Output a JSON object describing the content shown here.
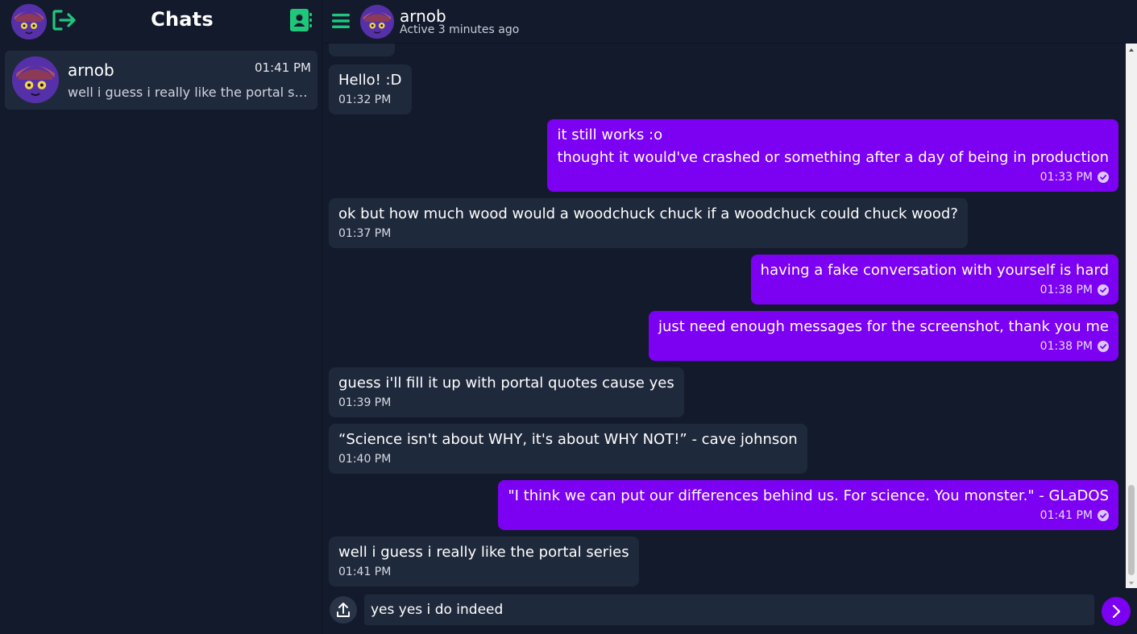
{
  "colors": {
    "background": "#131a2c",
    "panel": "#1f293c",
    "accent": "#7c00f2",
    "icon_green": "#1fc77b"
  },
  "sidebar": {
    "title": "Chats",
    "icons": {
      "logout": "logout-icon",
      "contacts": "contacts-icon"
    },
    "chats": [
      {
        "name": "arnob",
        "time": "01:41 PM",
        "preview": "well i guess i really like the portal series"
      }
    ]
  },
  "header": {
    "name": "arnob",
    "status": "Active 3 minutes ago"
  },
  "messages": [
    {
      "direction": "in",
      "lines": [
        "Hello! :D"
      ],
      "time": "01:32 PM"
    },
    {
      "direction": "out",
      "lines": [
        "it still works :o",
        "thought it would've crashed or something after a day of being in production"
      ],
      "time": "01:33 PM"
    },
    {
      "direction": "in",
      "lines": [
        "ok but how much wood would a woodchuck chuck if a woodchuck could chuck wood?"
      ],
      "time": "01:37 PM"
    },
    {
      "direction": "out",
      "lines": [
        "having a fake conversation with yourself is hard"
      ],
      "time": "01:38 PM"
    },
    {
      "direction": "out",
      "lines": [
        "just need enough messages for the screenshot, thank you me"
      ],
      "time": "01:38 PM"
    },
    {
      "direction": "in",
      "lines": [
        "guess i'll fill it up with portal quotes cause yes"
      ],
      "time": "01:39 PM"
    },
    {
      "direction": "in",
      "lines": [
        "“Science isn't about WHY, it's about WHY NOT!” - cave johnson"
      ],
      "time": "01:40 PM"
    },
    {
      "direction": "out",
      "lines": [
        "\"I think we can put our differences behind us. For science. You monster.\" - GLaDOS"
      ],
      "time": "01:41 PM"
    },
    {
      "direction": "in",
      "lines": [
        "well i guess i really like the portal series"
      ],
      "time": "01:41 PM"
    }
  ],
  "composer": {
    "value": "yes yes i do indeed"
  }
}
